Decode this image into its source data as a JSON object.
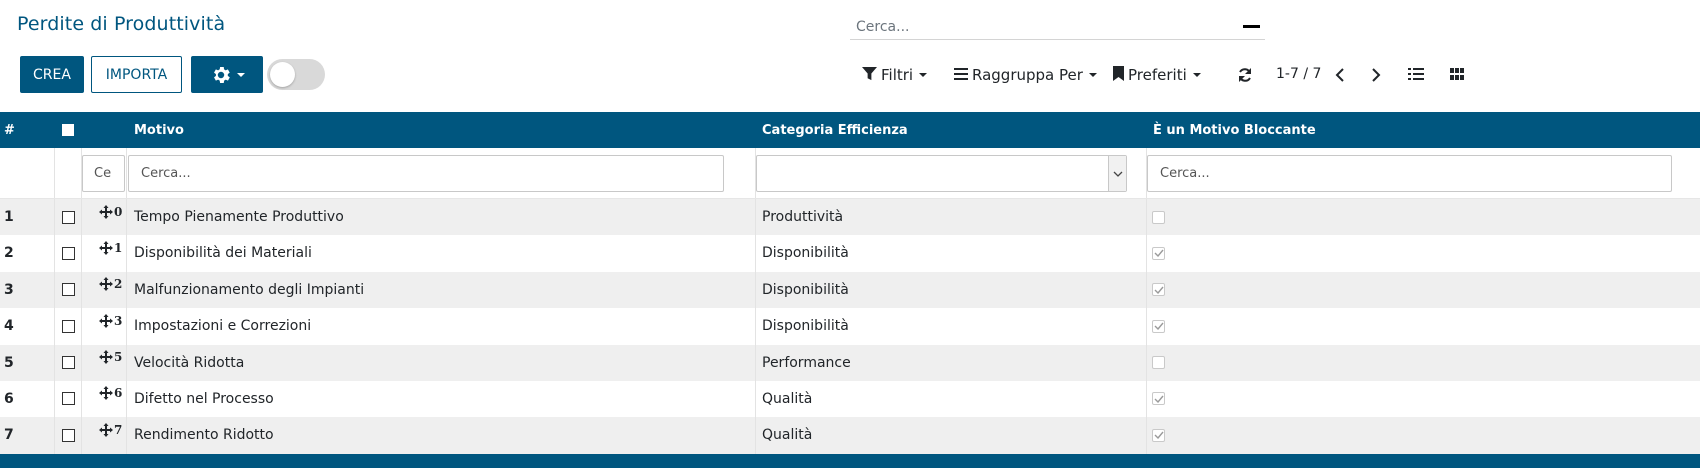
{
  "page": {
    "title": "Perdite di Produttività"
  },
  "toolbar": {
    "create_label": "CREA",
    "import_label": "IMPORTA",
    "search_placeholder": "Cerca...",
    "filters_label": "Filtri",
    "group_by_label": "Raggruppa Per",
    "favorites_label": "Preferiti",
    "pager_text": "1-7 / 7"
  },
  "icons": {
    "gear": "gear-icon",
    "filter": "filter-icon",
    "group": "list-bars-icon",
    "bookmark": "bookmark-icon",
    "refresh": "refresh-icon",
    "prev": "chevron-left-icon",
    "next": "chevron-right-icon",
    "list_view": "list-view-icon",
    "kanban_view": "kanban-view-icon",
    "drag": "move-handle-icon"
  },
  "colors": {
    "brand": "#00567f",
    "row_alt": "#efefef"
  },
  "table": {
    "headers": {
      "num": "#",
      "reason": "Motivo",
      "category": "Categoria Efficienza",
      "blocking": "È un Motivo Bloccante"
    },
    "filters": {
      "seq_placeholder": "Ce",
      "reason_placeholder": "Cerca...",
      "category_value": "",
      "blocking_placeholder": "Cerca..."
    },
    "rows": [
      {
        "num": "1",
        "seq": "0",
        "reason": "Tempo Pienamente Produttivo",
        "category": "Produttività",
        "blocking": false
      },
      {
        "num": "2",
        "seq": "1",
        "reason": "Disponibilità dei Materiali",
        "category": "Disponibilità",
        "blocking": true
      },
      {
        "num": "3",
        "seq": "2",
        "reason": "Malfunzionamento degli Impianti",
        "category": "Disponibilità",
        "blocking": true
      },
      {
        "num": "4",
        "seq": "3",
        "reason": "Impostazioni e Correzioni",
        "category": "Disponibilità",
        "blocking": true
      },
      {
        "num": "5",
        "seq": "5",
        "reason": "Velocità Ridotta",
        "category": "Performance",
        "blocking": false
      },
      {
        "num": "6",
        "seq": "6",
        "reason": "Difetto nel Processo",
        "category": "Qualità",
        "blocking": true
      },
      {
        "num": "7",
        "seq": "7",
        "reason": "Rendimento Ridotto",
        "category": "Qualità",
        "blocking": true
      }
    ]
  }
}
